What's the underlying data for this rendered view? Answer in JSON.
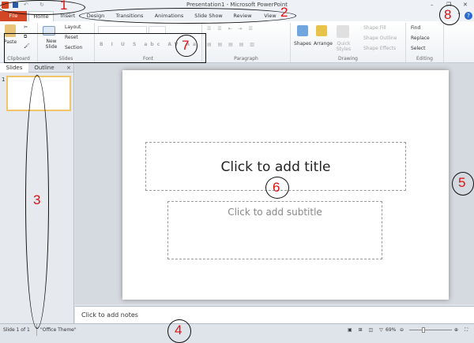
{
  "window": {
    "title": "Presentation1 - Microsoft PowerPoint"
  },
  "tabs": [
    "File",
    "Home",
    "Insert",
    "Design",
    "Transitions",
    "Animations",
    "Slide Show",
    "Review",
    "View"
  ],
  "ribbon": {
    "clipboard": {
      "label": "Clipboard",
      "paste": "Paste"
    },
    "slides": {
      "label": "Slides",
      "new_slide": "New Slide",
      "layout": "Layout",
      "reset": "Reset",
      "section": "Section"
    },
    "font": {
      "label": "Font"
    },
    "paragraph": {
      "label": "Paragraph"
    },
    "drawing": {
      "label": "Drawing",
      "shapes": "Shapes",
      "arrange": "Arrange",
      "quick_styles": "Quick Styles",
      "shape_fill": "Shape Fill",
      "shape_outline": "Shape Outline",
      "shape_effects": "Shape Effects"
    },
    "editing": {
      "label": "Editing",
      "find": "Find",
      "replace": "Replace",
      "select": "Select"
    }
  },
  "slides_pane": {
    "tabs": [
      "Slides",
      "Outline"
    ],
    "close": "×",
    "thumb_number": "1"
  },
  "slide": {
    "title_placeholder": "Click to add title",
    "subtitle_placeholder": "Click to add subtitle"
  },
  "notes": {
    "placeholder": "Click to add notes"
  },
  "status": {
    "slide_count": "Slide 1 of 1",
    "theme": "\"Office Theme\"",
    "zoom": "69%"
  },
  "annotations": [
    "1",
    "2",
    "3",
    "4",
    "5",
    "6",
    "7",
    "8"
  ]
}
